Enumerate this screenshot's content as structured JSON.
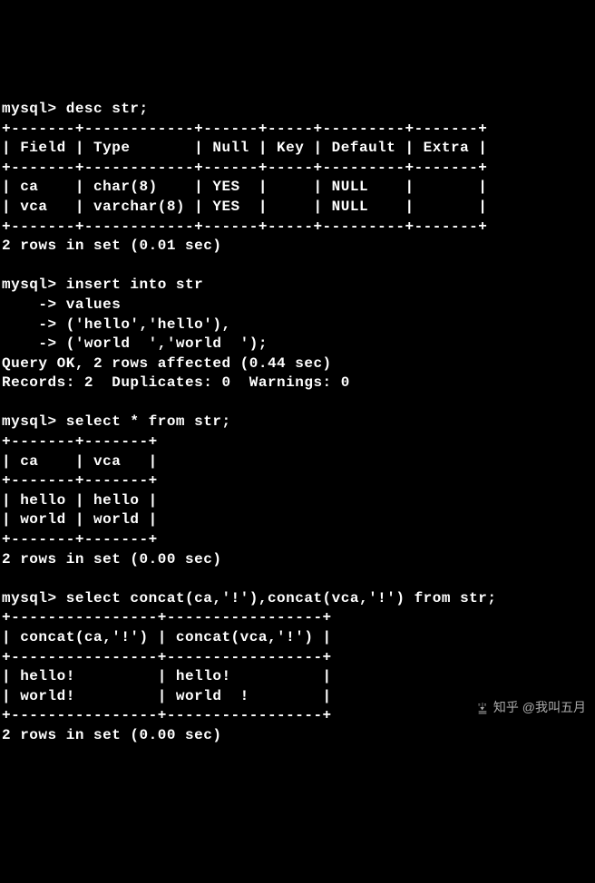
{
  "lines": {
    "l00": "mysql> desc str;",
    "l01": "+-------+------------+------+-----+---------+-------+",
    "l02": "| Field | Type       | Null | Key | Default | Extra |",
    "l03": "+-------+------------+------+-----+---------+-------+",
    "l04": "| ca    | char(8)    | YES  |     | NULL    |       |",
    "l05": "| vca   | varchar(8) | YES  |     | NULL    |       |",
    "l06": "+-------+------------+------+-----+---------+-------+",
    "l07": "2 rows in set (0.01 sec)",
    "l08": "",
    "l09": "mysql> insert into str",
    "l10": "    -> values",
    "l11": "    -> ('hello','hello'),",
    "l12": "    -> ('world  ','world  ');",
    "l13": "Query OK, 2 rows affected (0.44 sec)",
    "l14": "Records: 2  Duplicates: 0  Warnings: 0",
    "l15": "",
    "l16": "mysql> select * from str;",
    "l17": "+-------+-------+",
    "l18": "| ca    | vca   |",
    "l19": "+-------+-------+",
    "l20": "| hello | hello |",
    "l21": "| world | world |",
    "l22": "+-------+-------+",
    "l23": "2 rows in set (0.00 sec)",
    "l24": "",
    "l25": "mysql> select concat(ca,'!'),concat(vca,'!') from str;",
    "l26": "+----------------+-----------------+",
    "l27": "| concat(ca,'!') | concat(vca,'!') |",
    "l28": "+----------------+-----------------+",
    "l29": "| hello!         | hello!          |",
    "l30": "| world!         | world  !        |",
    "l31": "+----------------+-----------------+",
    "l32": "2 rows in set (0.00 sec)"
  },
  "watermark": {
    "text": "知乎 @我叫五月"
  }
}
